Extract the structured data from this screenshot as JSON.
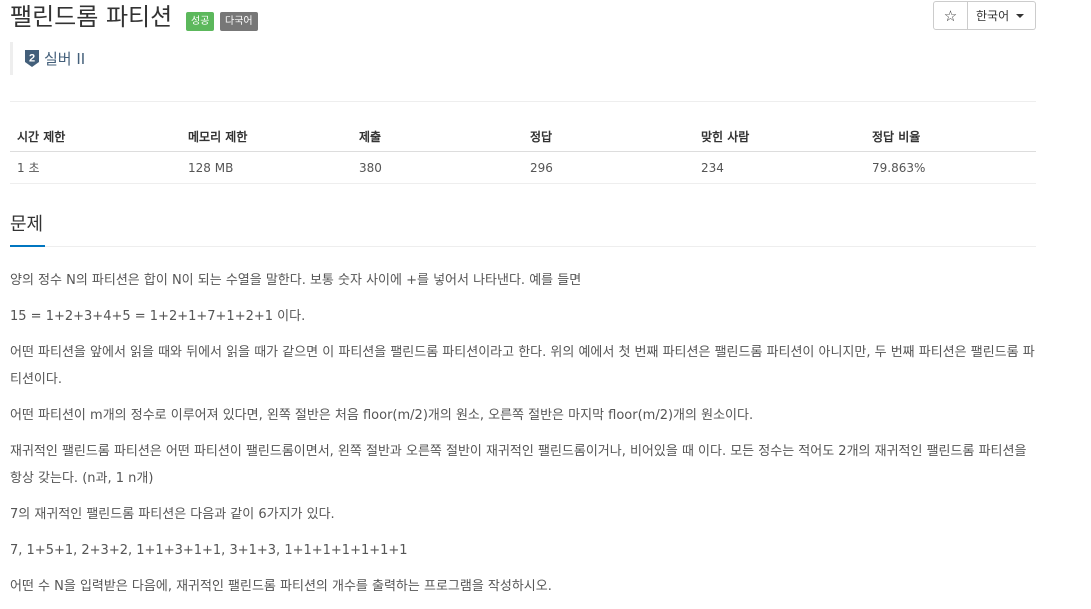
{
  "header": {
    "title": "팰린드롬 파티션",
    "labels": {
      "success": "성공",
      "multilang": "다국어"
    },
    "star_icon": "☆",
    "language_button": "한국어"
  },
  "tier": {
    "badge_number": "2",
    "text": "실버 II",
    "color": "#435f7a"
  },
  "info_table": {
    "headers": [
      "시간 제한",
      "메모리 제한",
      "제출",
      "정답",
      "맞힌 사람",
      "정답 비율"
    ],
    "values": [
      "1 초",
      "128 MB",
      "380",
      "296",
      "234",
      "79.863%"
    ]
  },
  "problem": {
    "section_title": "문제",
    "paragraphs": [
      "양의 정수 N의 파티션은 합이 N이 되는 수열을 말한다. 보통 숫자 사이에 +를 넣어서 나타낸다. 예를 들면",
      "15 = 1+2+3+4+5 = 1+2+1+7+1+2+1 이다.",
      "어떤 파티션을 앞에서 읽을 때와 뒤에서 읽을 때가 같으면 이 파티션을 팰린드롬 파티션이라고 한다. 위의 예에서 첫 번째 파티션은 팰린드롬 파티션이 아니지만, 두 번째 파티션은 팰린드롬 파티션이다.",
      "어떤 파티션이 m개의 정수로 이루어져 있다면, 왼쪽 절반은 처음 floor(m/2)개의 원소, 오른쪽 절반은 마지막 floor(m/2)개의 원소이다.",
      "재귀적인 팰린드롬 파티션은 어떤 파티션이 팰린드롬이면서, 왼쪽 절반과 오른쪽 절반이 재귀적인 팰린드롬이거나, 비어있을 때 이다. 모든 정수는 적어도 2개의 재귀적인 팰린드롬 파티션을 항상 갖는다. (n과, 1 n개)",
      "7의 재귀적인 팰린드롬 파티션은 다음과 같이 6가지가 있다.",
      "7, 1+5+1, 2+3+2, 1+1+3+1+1, 3+1+3, 1+1+1+1+1+1+1",
      "어떤 수 N을 입력받은 다음에, 재귀적인 팰린드롬 파티션의 개수를 출력하는 프로그램을 작성하시오."
    ]
  },
  "colors": {
    "success_label": "#5cb85c",
    "lang_label": "#777777",
    "section_underline": "#0076c0"
  }
}
